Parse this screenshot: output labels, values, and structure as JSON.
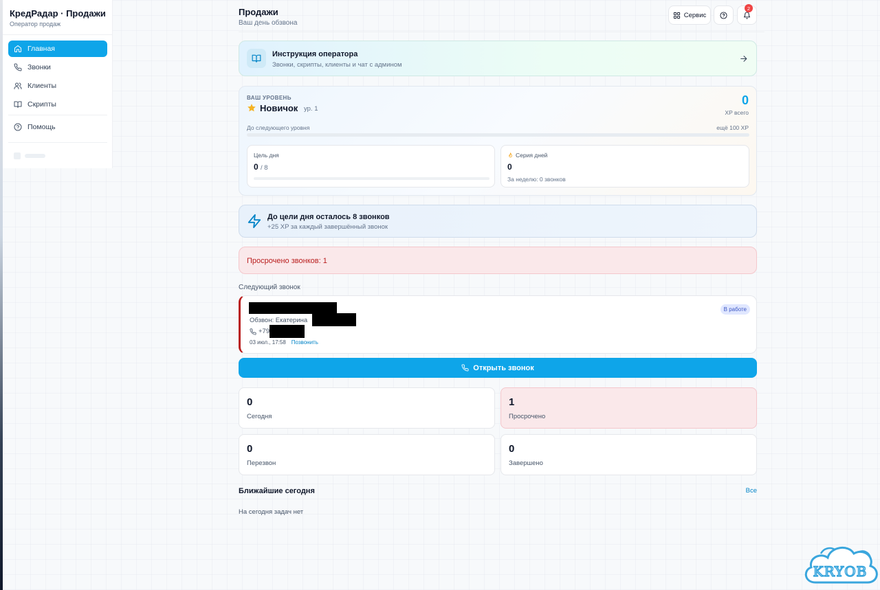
{
  "app": {
    "brand_title": "КредРадар · Продажи",
    "brand_subtitle": "Оператор продаж"
  },
  "sidebar": {
    "items": [
      {
        "label": "Главная",
        "icon": "home-icon",
        "active": true
      },
      {
        "label": "Звонки",
        "icon": "phone-icon",
        "active": false
      },
      {
        "label": "Клиенты",
        "icon": "users-icon",
        "active": false
      },
      {
        "label": "Скрипты",
        "icon": "book-icon",
        "active": false
      },
      {
        "label": "Помощь",
        "icon": "help-circle-icon",
        "active": false
      }
    ]
  },
  "header": {
    "title": "Продажи",
    "subtitle": "Ваш день обзвона",
    "service_label": "Сервис",
    "notifications_count": "2"
  },
  "instruction": {
    "title": "Инструкция оператора",
    "subtitle": "Звонки, скрипты, клиенты и чат с админом"
  },
  "level": {
    "label": "ВАШ УРОВЕНЬ",
    "name": "Новичок",
    "rank": "ур. 1",
    "xp_total": "0",
    "xp_caption": "XP всего",
    "next_label": "До следующего уровня",
    "next_remaining": "ещё 100 XP",
    "progress_fraction": 0
  },
  "daily_goal": {
    "label": "Цель дня",
    "done": "0",
    "total": "/ 8",
    "progress_fraction": 0
  },
  "streak": {
    "label": "Серия дней",
    "value": "0",
    "week_note": "За неделю: 0 звонков"
  },
  "tip": {
    "title": "До цели дня осталось 8 звонков",
    "subtitle": "+25 XP за каждый завершённый звонок"
  },
  "overdue_banner": {
    "text": "Просрочено звонков: 1"
  },
  "next_call": {
    "section_title": "Следующий звонок",
    "campaign": "Обзвон: Екатерина",
    "phone_prefix": "+79",
    "datetime": "03 июл., 17:58",
    "call_action": "Позвонить",
    "status": "В работе",
    "open_button": "Открыть звонок"
  },
  "stats": [
    {
      "value": "0",
      "label": "Сегодня"
    },
    {
      "value": "1",
      "label": "Просрочено"
    },
    {
      "value": "0",
      "label": "Перезвон"
    },
    {
      "value": "0",
      "label": "Завершено"
    }
  ],
  "upcoming": {
    "title": "Ближайшие сегодня",
    "see_all": "Все",
    "empty_text": "На сегодня задач нет"
  },
  "watermark": {
    "text": "KRYOB"
  },
  "colors": {
    "accent": "#0ea5e9",
    "danger": "#b91c1c",
    "danger_bg": "#fae8ea",
    "status_pill_bg": "#e0e7ff"
  }
}
